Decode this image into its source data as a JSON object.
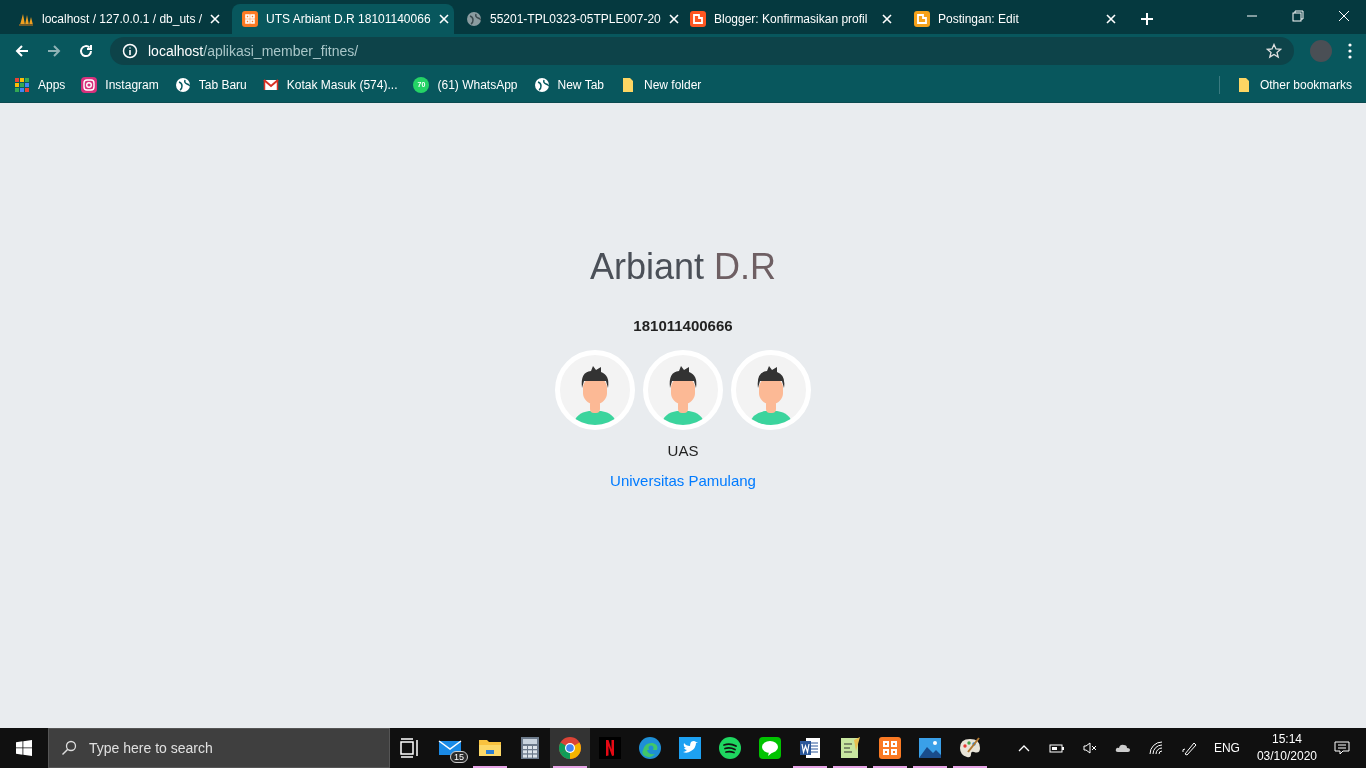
{
  "tabs": [
    {
      "title": "localhost / 127.0.0.1 / db_uts /",
      "kind": "sail",
      "selected": false
    },
    {
      "title": "UTS Arbiant D.R 18101140066",
      "kind": "xampp",
      "selected": true
    },
    {
      "title": "55201-TPL0323-05TPLE007-20",
      "kind": "globe",
      "selected": false
    },
    {
      "title": "Blogger: Konfirmasikan profil",
      "kind": "blogger",
      "selected": false
    },
    {
      "title": "Postingan: Edit",
      "kind": "blogger-light",
      "selected": false
    }
  ],
  "address_bar": {
    "host": "localhost",
    "path": "/aplikasi_member_fitnes/"
  },
  "bookmarks": [
    {
      "label": "Apps",
      "kind": "apps"
    },
    {
      "label": "Instagram",
      "kind": "instagram"
    },
    {
      "label": "Tab Baru",
      "kind": "globe"
    },
    {
      "label": "Kotak Masuk (574)...",
      "kind": "gmail"
    },
    {
      "label": "(61) WhatsApp",
      "kind": "whatsapp",
      "icon_text": "70"
    },
    {
      "label": "New Tab",
      "kind": "globe"
    },
    {
      "label": "New folder",
      "kind": "folder"
    }
  ],
  "other_bookmarks": "Other bookmarks",
  "page": {
    "name_first": "Arbiant",
    "name_last": "D.R",
    "student_id": "181011400666",
    "members": [
      {
        "kind": "avatar"
      },
      {
        "kind": "avatar"
      },
      {
        "kind": "avatar"
      }
    ],
    "caption": "UAS",
    "link": "Universitas Pamulang"
  },
  "taskbar": {
    "search_placeholder": "Type here to search",
    "apps": [
      {
        "kind": "taskview",
        "running": false,
        "selected": false
      },
      {
        "kind": "mail",
        "running": false,
        "selected": false,
        "badge": "15"
      },
      {
        "kind": "files",
        "running": true,
        "selected": false
      },
      {
        "kind": "calculator",
        "running": false,
        "selected": false
      },
      {
        "kind": "chrome",
        "running": true,
        "selected": true
      },
      {
        "kind": "netflix",
        "running": false,
        "selected": false
      },
      {
        "kind": "edge",
        "running": false,
        "selected": false
      },
      {
        "kind": "twitter",
        "running": false,
        "selected": false
      },
      {
        "kind": "spotify",
        "running": false,
        "selected": false
      },
      {
        "kind": "line",
        "running": false,
        "selected": false
      },
      {
        "kind": "word",
        "running": true,
        "selected": false
      },
      {
        "kind": "notepad",
        "running": true,
        "selected": false
      },
      {
        "kind": "xampp",
        "running": true,
        "selected": false
      },
      {
        "kind": "photos",
        "running": true,
        "selected": false
      },
      {
        "kind": "paint",
        "running": true,
        "selected": false
      }
    ],
    "language": "ENG",
    "time": "15:14",
    "date": "03/10/2020"
  }
}
